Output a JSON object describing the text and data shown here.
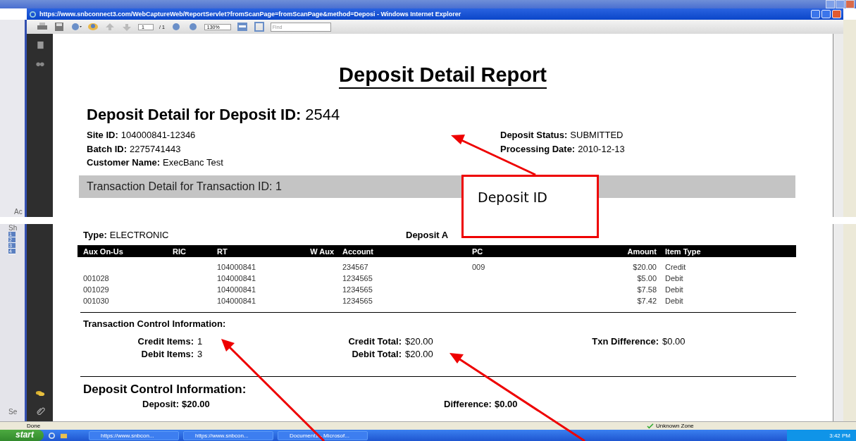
{
  "back_window": {
    "top_label": "Ac",
    "bottom_label": "Sh",
    "row_numbers": [
      "1",
      "2",
      "3",
      "4"
    ],
    "footer_label": "Se"
  },
  "browser": {
    "title": "https://www.snbconnect3.com/WebCaptureWeb/ReportServlet?fromScanPage=fromScanPage&method=Deposi - Windows Internet Explorer",
    "page_number": "1",
    "page_total": "/ 1",
    "zoom": "130%",
    "find_placeholder": "Find"
  },
  "report": {
    "title": "Deposit Detail Report",
    "heading": {
      "label": "Deposit Detail for Deposit ID:",
      "value": "2544"
    },
    "left_fields": [
      {
        "label": "Site ID:",
        "value": "104000841-12346"
      },
      {
        "label": "Batch ID:",
        "value": "2275741443"
      },
      {
        "label": "Customer Name:",
        "value": "ExecBanc Test"
      }
    ],
    "right_fields": [
      {
        "label": "Deposit Status:",
        "value": "SUBMITTED"
      },
      {
        "label": "Processing Date:",
        "value": "2010-12-13"
      }
    ],
    "section_bar": "Transaction Detail for Transaction ID: 1",
    "type": {
      "label": "Type:",
      "value": "ELECTRONIC"
    },
    "deposit_partial": "Deposit A",
    "table": {
      "columns": [
        "Aux On-Us",
        "RIC",
        "RT",
        "W Aux",
        "Account",
        "PC",
        "Amount",
        "Item Type"
      ],
      "rows": [
        [
          "",
          "",
          "104000841",
          "",
          "234567",
          "009",
          "$20.00",
          "Credit"
        ],
        [
          "001028",
          "",
          "104000841",
          "",
          "1234565",
          "",
          "$5.00",
          "Debit"
        ],
        [
          "001029",
          "",
          "104000841",
          "",
          "1234565",
          "",
          "$7.58",
          "Debit"
        ],
        [
          "001030",
          "",
          "104000841",
          "",
          "1234565",
          "",
          "$7.42",
          "Debit"
        ]
      ]
    },
    "transaction_control": {
      "title": "Transaction Control Information:",
      "items": [
        {
          "label": "Credit Items:",
          "value": "1"
        },
        {
          "label": "Credit Total:",
          "value": "$20.00"
        },
        {
          "label": "Txn Difference:",
          "value": "$0.00"
        },
        {
          "label": "Debit Items:",
          "value": "3"
        },
        {
          "label": "Debit Total:",
          "value": "$20.00"
        }
      ]
    },
    "deposit_control": {
      "title": "Deposit Control Information:",
      "items": [
        {
          "label": "Deposit:",
          "value": "$20.00"
        },
        {
          "label": "Difference:",
          "value": "$0.00"
        }
      ]
    }
  },
  "callout": {
    "text": "Deposit ID"
  },
  "status_bar": {
    "text": "Done",
    "zone": "Unknown Zone"
  },
  "taskbar": {
    "start": "start",
    "tasks": [
      "https://www.snbcon...",
      "https://www.snbcon...",
      "Document1 - Microsof..."
    ],
    "clock": "3:42 PM"
  }
}
